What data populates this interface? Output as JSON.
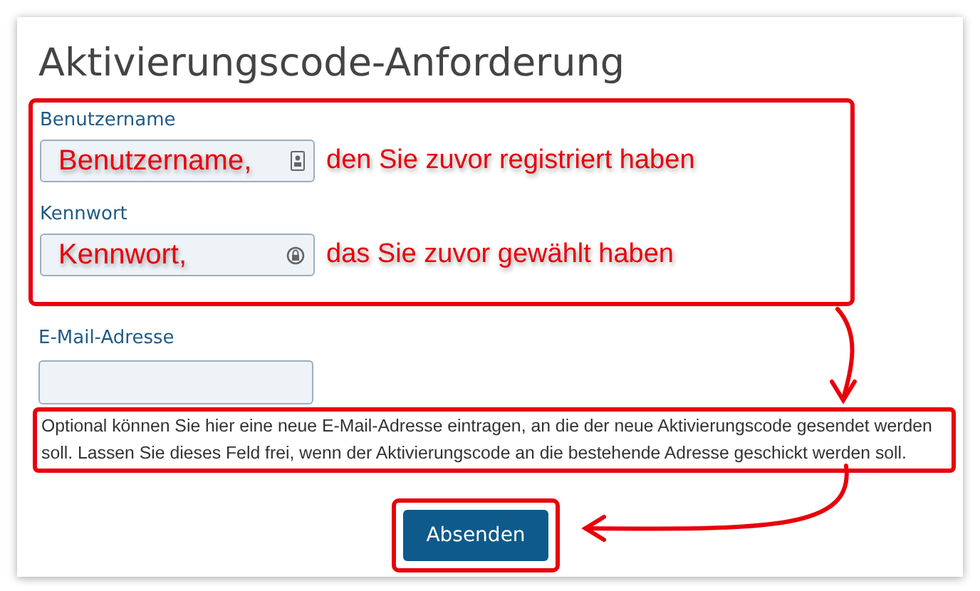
{
  "title": "Aktivierungscode-Anforderung",
  "highlighted_fields": [
    {
      "label": "Benutzername",
      "annotation_inside": "Benutzername,",
      "annotation_beside": "den Sie zuvor registriert haben",
      "kind": "user"
    },
    {
      "label": "Kennwort",
      "annotation_inside": "Kennwort,",
      "annotation_beside": "das Sie zuvor gewählt haben",
      "kind": "key"
    }
  ],
  "email_field": {
    "label": "E-Mail-Adresse"
  },
  "help_text": "Optional können Sie hier eine neue E-Mail-Adresse eintragen, an die der neue Aktivierungscode gesendet werden soll. Lassen Sie dieses Feld frei, wenn der Aktivierungscode an die bestehende Adresse geschickt werden soll.",
  "submit_button": "Absenden"
}
